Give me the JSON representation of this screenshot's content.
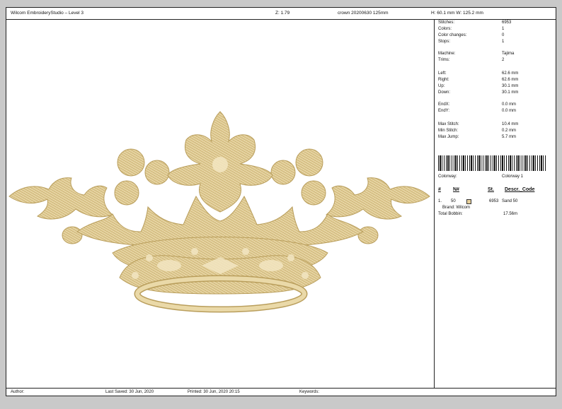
{
  "header": {
    "app_title": "Wilcom EmbroideryStudio – Level 3",
    "zoom": "Z: 1.79",
    "design_name": "crown 20200630 125mm",
    "size": "H: 60.1 mm   W: 125.2 mm"
  },
  "stats": [
    {
      "label": "Stitches:",
      "value": "6953"
    },
    {
      "label": "Colors:",
      "value": "1"
    },
    {
      "label": "Color changes:",
      "value": "0"
    },
    {
      "label": "Stops:",
      "value": "1"
    },
    {
      "label": "Machine:",
      "value": "Tajima"
    },
    {
      "label": "Trims:",
      "value": "2"
    },
    {
      "label": "Left:",
      "value": "62.6 mm"
    },
    {
      "label": "Right:",
      "value": "62.6 mm"
    },
    {
      "label": "Up:",
      "value": "30.1 mm"
    },
    {
      "label": "Down:",
      "value": "30.1 mm"
    },
    {
      "label": "EndX:",
      "value": "0.0 mm"
    },
    {
      "label": "EndY:",
      "value": "0.0 mm"
    },
    {
      "label": "Max Stitch:",
      "value": "10.4 mm"
    },
    {
      "label": "Min Stitch:",
      "value": "0.2 mm"
    },
    {
      "label": "Max Jump:",
      "value": "5.7 mm"
    }
  ],
  "colorway": {
    "label": "Colorway:",
    "value": "Colorway 1"
  },
  "color_table": {
    "headers": [
      "#",
      "N#",
      "St.",
      "Descr._Code"
    ],
    "row": {
      "index": "1.",
      "code": "50",
      "stitches": "6953",
      "descr": "Sand 50",
      "brand": "Brand: Wilcom",
      "swatch_color": "#e6cf9b"
    }
  },
  "bobbin": {
    "label": "Total Bobbin:",
    "value": "17.56m"
  },
  "footer": {
    "author": "Author:",
    "last_saved": "Last Saved: 30 Jun, 2020",
    "printed": "Printed: 30 Jun, 2020 20:15",
    "keywords": "Keywords:"
  },
  "colors": {
    "thread": "#e2cd95",
    "thread_shadow": "#b99e5c",
    "thread_highlight": "#f3e6c2"
  }
}
